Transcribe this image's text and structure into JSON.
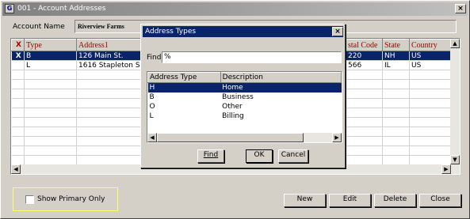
{
  "window": {
    "title": "001 - Account Addresses",
    "icon_text": "G",
    "close_label": "×"
  },
  "account": {
    "label": "Account Name",
    "value": "Riverview Farms"
  },
  "grid": {
    "columns": [
      "X",
      "Type",
      "Address1",
      "stal Code",
      "State",
      "Country"
    ],
    "rows": [
      {
        "x": "X",
        "type": "B",
        "address1": "126 Main St.",
        "postal": "220",
        "state": "NH",
        "country": "US",
        "selected": true
      },
      {
        "x": "",
        "type": "L",
        "address1": "1616 Stapleton St",
        "postal": "566",
        "state": "IL",
        "country": "US",
        "selected": false
      }
    ],
    "empty_rows": 11
  },
  "show_primary": {
    "label": "Show Primary Only",
    "checked": false
  },
  "buttons": {
    "new": "New",
    "edit": "Edit",
    "delete": "Delete",
    "close": "Close"
  },
  "dialog": {
    "title": "Address Types",
    "close_label": "×",
    "find_label": "Find",
    "find_value": "%",
    "columns": [
      "Address Type",
      "Description"
    ],
    "rows": [
      {
        "code": "H",
        "description": "Home",
        "selected": true
      },
      {
        "code": "B",
        "description": "Business",
        "selected": false
      },
      {
        "code": "O",
        "description": "Other",
        "selected": false
      },
      {
        "code": "L",
        "description": "Billing",
        "selected": false
      }
    ],
    "buttons": {
      "find": "Find",
      "ok": "OK",
      "cancel": "Cancel"
    }
  },
  "colors": {
    "selection": "#0a246a",
    "header_text": "#a00000",
    "highlight_border": "#ffff66"
  }
}
